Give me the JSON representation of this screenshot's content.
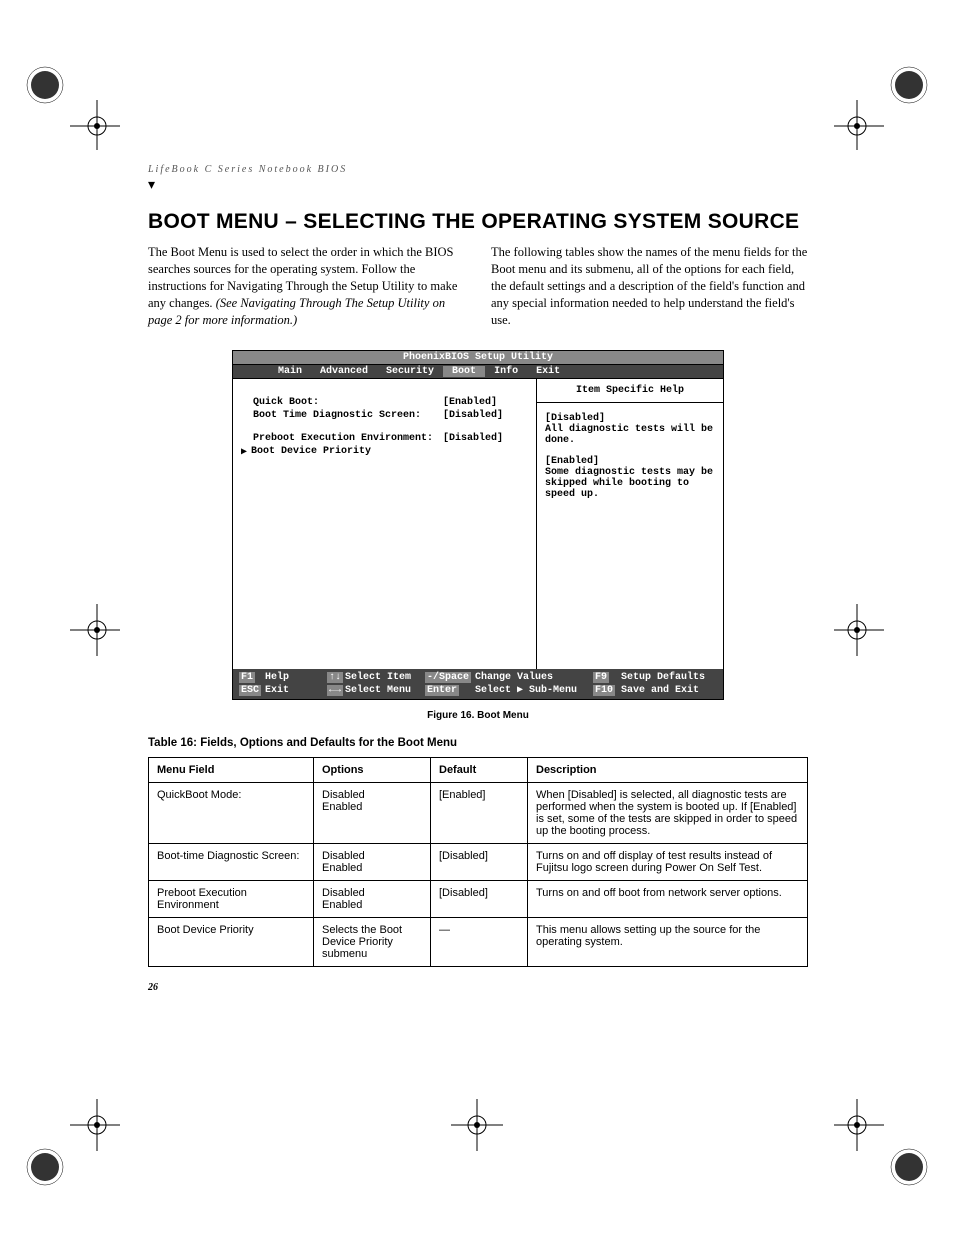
{
  "header": "LifeBook C Series Notebook BIOS",
  "title": "BOOT MENU – SELECTING THE OPERATING SYSTEM SOURCE",
  "intro_left_1": "The Boot Menu is used to select the order in which the BIOS searches sources for the operating system. Follow the instructions for Navigating Through the Setup Utility to make any changes. ",
  "intro_left_2": "(See Navigating Through The Setup Utility on page 2 for more information.)",
  "intro_right": "The following tables show the names of the menu fields for the Boot menu and its submenu, all of the options for each field, the default settings and a description of the field's function and any special information needed to help understand the field's use.",
  "bios": {
    "title": "PhoenixBIOS Setup Utility",
    "tabs": [
      "Main",
      "Advanced",
      "Security",
      "Boot",
      "Info",
      "Exit"
    ],
    "active_tab": "Boot",
    "rows": [
      {
        "label": "Quick Boot:",
        "value": "[Enabled]"
      },
      {
        "label": "Boot Time Diagnostic Screen:",
        "value": "[Disabled]"
      }
    ],
    "rows2": [
      {
        "label": "Preboot Execution Environment:",
        "value": "[Disabled]"
      }
    ],
    "submenu": "Boot Device Priority",
    "help_title": "Item Specific Help",
    "help_body_1": "[Disabled]",
    "help_body_2": "All diagnostic tests will be done.",
    "help_body_3": "[Enabled]",
    "help_body_4": "Some diagnostic tests may be skipped while booting to speed up.",
    "footer": {
      "f1": "F1",
      "help": "Help",
      "arrows_v": "↑↓",
      "select_item": "Select Item",
      "minus": "-/Space",
      "change": "Change Values",
      "f9": "F9",
      "defaults": "Setup Defaults",
      "esc": "ESC",
      "exit": "Exit",
      "arrows_h": "←→",
      "select_menu": "Select Menu",
      "enter": "Enter",
      "submenu": "Select ▶ Sub-Menu",
      "f10": "F10",
      "save": "Save and Exit"
    }
  },
  "figure_caption": "Figure 16.  Boot Menu",
  "table_caption": "Table 16: Fields, Options and Defaults for the Boot Menu",
  "table": {
    "headers": [
      "Menu Field",
      "Options",
      "Default",
      "Description"
    ],
    "rows": [
      {
        "field": "QuickBoot Mode:",
        "options": "Disabled\nEnabled",
        "default": "[Enabled]",
        "desc": "When [Disabled] is selected, all diagnostic tests are performed when the system is booted up. If [Enabled] is set, some of the tests are skipped in order to speed up the booting process."
      },
      {
        "field": "Boot-time Diagnostic Screen:",
        "options": "Disabled\nEnabled",
        "default": "[Disabled]",
        "desc": "Turns on and off display of test results instead of Fujitsu logo screen during Power On Self Test."
      },
      {
        "field": "Preboot Execution Environment",
        "options": "Disabled\nEnabled",
        "default": "[Disabled]",
        "desc": "Turns on and off boot from network server options."
      },
      {
        "field": "Boot Device Priority",
        "options": "Selects the Boot Device Priority submenu",
        "default": "—",
        "desc": "This menu allows setting up the source for the operating system."
      }
    ]
  },
  "page_number": "26"
}
